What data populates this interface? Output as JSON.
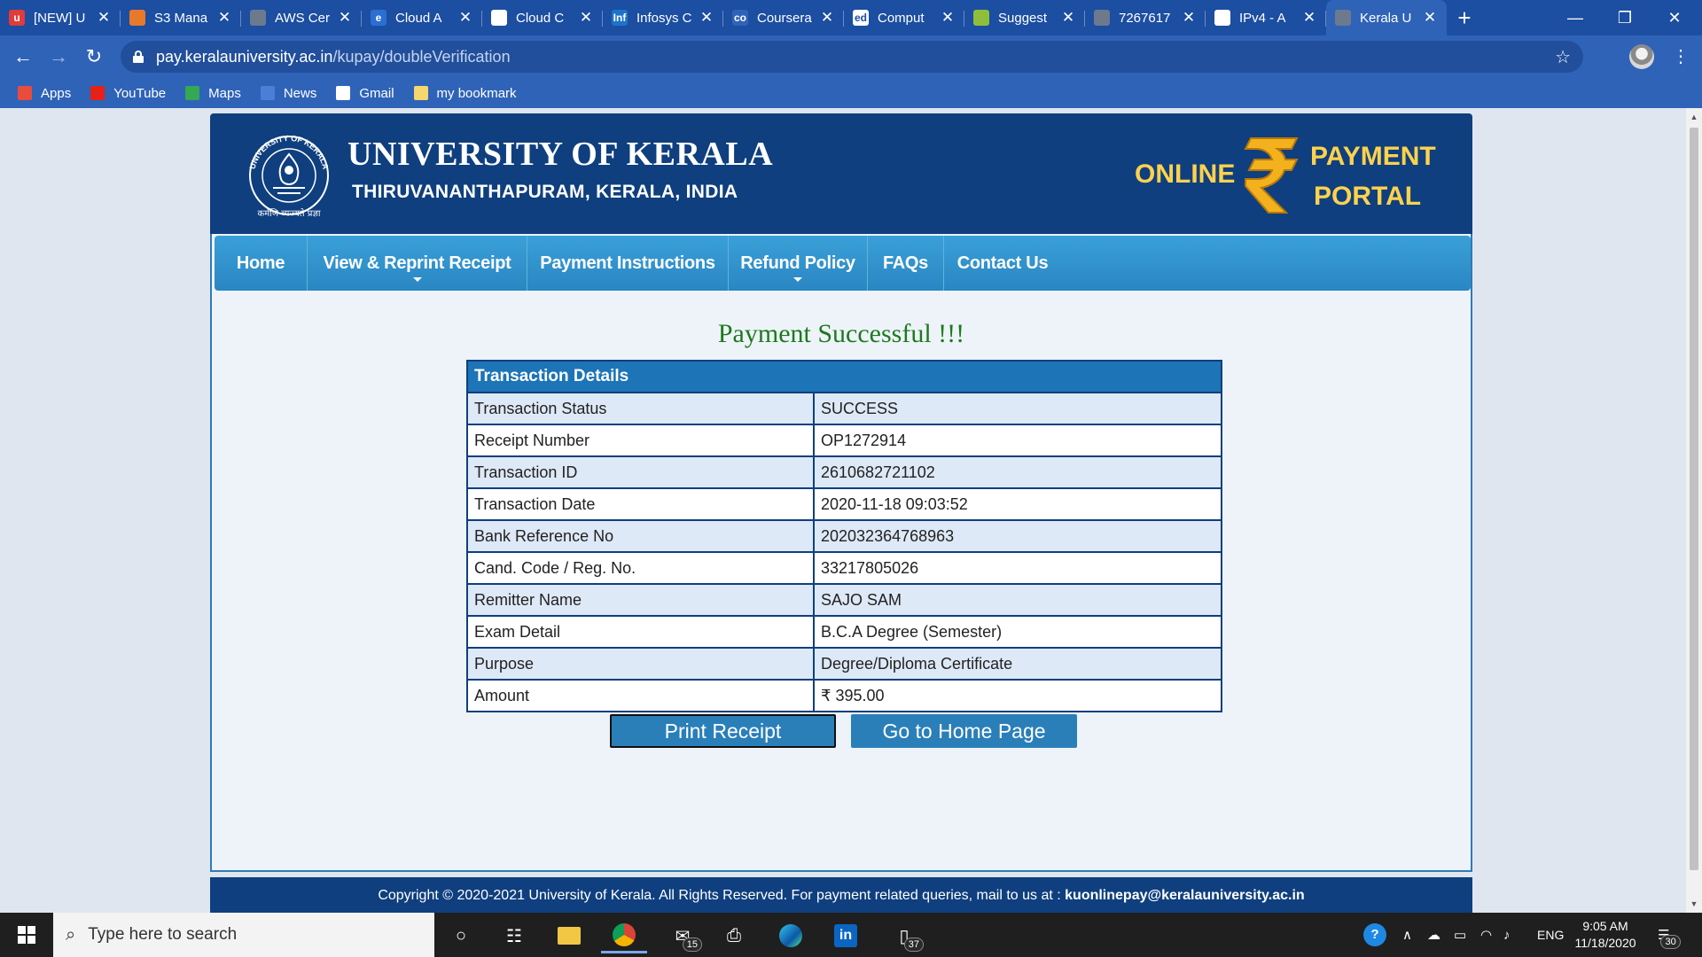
{
  "browser": {
    "tabs": [
      {
        "title": "[NEW] U",
        "icon": "udemy-icon",
        "color": "#e13b3b",
        "glyph": "u"
      },
      {
        "title": "S3 Mana",
        "icon": "aws-s3-icon",
        "color": "#e8792b",
        "glyph": ""
      },
      {
        "title": "AWS Cer",
        "icon": "globe-icon",
        "color": "#6d7a8d",
        "glyph": ""
      },
      {
        "title": "Cloud A",
        "icon": "edge-e-icon",
        "color": "#2a6fd1",
        "glyph": "e"
      },
      {
        "title": "Cloud C",
        "icon": "wipro-icon",
        "color": "#ffffff",
        "glyph": ""
      },
      {
        "title": "Infosys C",
        "icon": "infosys-icon",
        "color": "#1f72c9",
        "glyph": "Inf"
      },
      {
        "title": "Coursera",
        "icon": "coursera-icon",
        "color": "#2f63b8",
        "glyph": "co"
      },
      {
        "title": "Comput",
        "icon": "edx-icon",
        "color": "#ffffff",
        "glyph": "ed"
      },
      {
        "title": "Suggest",
        "icon": "bulb-icon",
        "color": "#8fbf3a",
        "glyph": ""
      },
      {
        "title": "7267617",
        "icon": "globe-icon",
        "color": "#6d7a8d",
        "glyph": ""
      },
      {
        "title": "IPv4 - A",
        "icon": "ipv4-icon",
        "color": "#ffffff",
        "glyph": ""
      },
      {
        "title": "Kerala U",
        "icon": "globe-icon",
        "color": "#6d7a8d",
        "glyph": "",
        "active": true
      }
    ],
    "new_tab": "+",
    "url_domain": "pay.keralauniversity.ac.in",
    "url_path": "/kupay/doubleVerification",
    "bookmarks": [
      {
        "label": "Apps",
        "icon": "apps-grid-icon",
        "color": "#e94b3c"
      },
      {
        "label": "YouTube",
        "icon": "youtube-icon",
        "color": "#e62117"
      },
      {
        "label": "Maps",
        "icon": "maps-icon",
        "color": "#34a853"
      },
      {
        "label": "News",
        "icon": "news-icon",
        "color": "#4a7fd8"
      },
      {
        "label": "Gmail",
        "icon": "gmail-icon",
        "color": "#ffffff"
      },
      {
        "label": "my bookmark",
        "icon": "folder-icon",
        "color": "#f5d76e"
      }
    ]
  },
  "header": {
    "university": "UNIVERSITY OF KERALA",
    "location": "THIRUVANANTHAPURAM, KERALA, INDIA",
    "seal_text_top": "UNIVERSITY OF KERALA",
    "seal_motto": "कर्मणि व्यज्यते प्रज्ञा",
    "online": "ONLINE",
    "payment": "PAYMENT",
    "portal": "PORTAL"
  },
  "nav": [
    {
      "label": "Home",
      "sub": false
    },
    {
      "label": "View & Reprint Receipt",
      "sub": true
    },
    {
      "label": "Payment Instructions",
      "sub": false
    },
    {
      "label": "Refund Policy",
      "sub": true
    },
    {
      "label": "FAQs",
      "sub": false
    },
    {
      "label": "Contact Us",
      "sub": false
    }
  ],
  "main": {
    "title": "Payment Successful !!!",
    "table_header": "Transaction Details",
    "rows": [
      {
        "label": "Transaction Status",
        "value": "SUCCESS"
      },
      {
        "label": "Receipt Number",
        "value": "OP1272914"
      },
      {
        "label": "Transaction ID",
        "value": "2610682721102"
      },
      {
        "label": "Transaction Date",
        "value": "2020-11-18 09:03:52"
      },
      {
        "label": "Bank Reference No",
        "value": "202032364768963"
      },
      {
        "label": "Cand. Code / Reg. No.",
        "value": "33217805026"
      },
      {
        "label": "Remitter Name",
        "value": "SAJO SAM"
      },
      {
        "label": "Exam Detail",
        "value": "B.C.A Degree (Semester)"
      },
      {
        "label": "Purpose",
        "value": "Degree/Diploma Certificate"
      },
      {
        "label": "Amount",
        "value": "₹ 395.00"
      }
    ],
    "print_button": "Print Receipt",
    "home_button": "Go to Home Page"
  },
  "footer": {
    "copyright": "Copyright © 2020-2021 University of Kerala. All Rights Reserved. For payment related queries, mail to us at : ",
    "email": "kuonlinepay@keralauniversity.ac.in"
  },
  "taskbar": {
    "search_placeholder": "Type here to search",
    "mail_badge": "15",
    "files_badge": "37",
    "language": "ENG",
    "time": "9:05 AM",
    "date": "11/18/2020",
    "notifications": "30"
  }
}
